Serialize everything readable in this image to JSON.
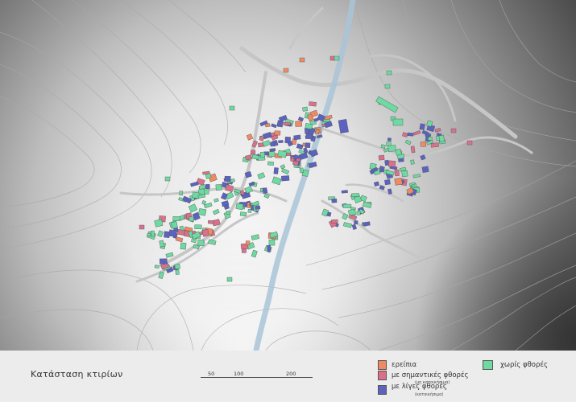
{
  "title": "Κατάσταση κτιρίων",
  "scale": {
    "labels": [
      "50",
      "100",
      "200"
    ]
  },
  "legend": [
    {
      "key": "ruin",
      "label": "ερείπια",
      "sublabel": "",
      "color": "#f08a63"
    },
    {
      "key": "major",
      "label": "με σημαντικές φθορές",
      "sublabel": "(μη κατοικήσιμα)",
      "color": "#d9718a"
    },
    {
      "key": "minor",
      "label": "με λίγες φθορές",
      "sublabel": "(κατοικήσιμα)",
      "color": "#5b62bf"
    },
    {
      "key": "none",
      "label": "χωρίς φθορές",
      "sublabel": "",
      "color": "#6ed9a1"
    }
  ],
  "colors": {
    "river": "#a9c4d8",
    "road": "#c9c9c9",
    "contour": "#b0b0b0",
    "building_outline": "#555555"
  }
}
